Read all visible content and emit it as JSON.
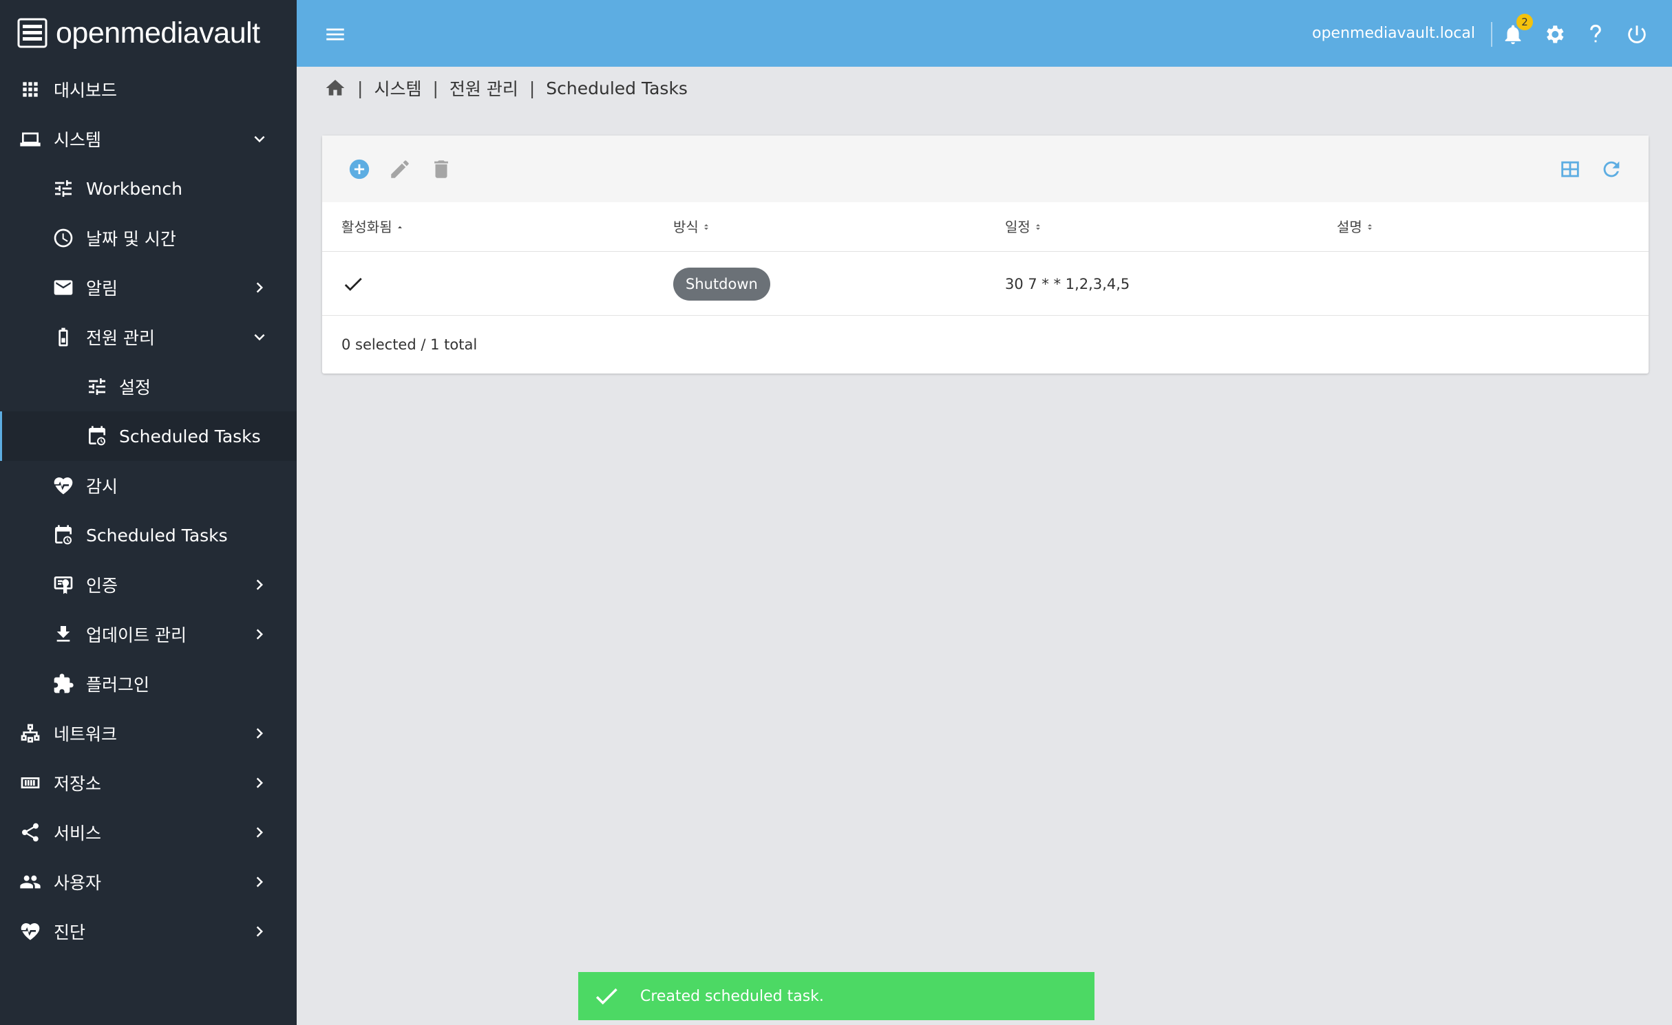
{
  "app": {
    "brand": "openmediavault"
  },
  "sidebar": {
    "items": [
      {
        "label": "대시보드",
        "icon": "dashboard-grid-icon"
      },
      {
        "label": "시스템",
        "icon": "laptop-icon",
        "expanded": true
      },
      {
        "label": "Workbench",
        "icon": "tune-icon"
      },
      {
        "label": "날짜 및 시간",
        "icon": "clock-icon"
      },
      {
        "label": "알림",
        "icon": "mail-icon"
      },
      {
        "label": "전원 관리",
        "icon": "battery-icon",
        "expanded": true
      },
      {
        "label": "설정",
        "icon": "tune-icon"
      },
      {
        "label": "Scheduled Tasks",
        "icon": "calendar-clock-icon",
        "active": true
      },
      {
        "label": "감시",
        "icon": "heart-pulse-icon"
      },
      {
        "label": "Scheduled Tasks",
        "icon": "calendar-clock-icon"
      },
      {
        "label": "인증",
        "icon": "certificate-icon"
      },
      {
        "label": "업데이트 관리",
        "icon": "download-icon"
      },
      {
        "label": "플러그인",
        "icon": "puzzle-icon"
      },
      {
        "label": "네트워크",
        "icon": "network-icon"
      },
      {
        "label": "저장소",
        "icon": "storage-icon"
      },
      {
        "label": "서비스",
        "icon": "share-icon"
      },
      {
        "label": "사용자",
        "icon": "users-icon"
      },
      {
        "label": "진단",
        "icon": "heart-pulse-icon"
      }
    ]
  },
  "topbar": {
    "hostname": "openmediavault.local",
    "notification_count": "2"
  },
  "breadcrumb": {
    "items": [
      "시스템",
      "전원 관리",
      "Scheduled Tasks"
    ]
  },
  "table": {
    "columns": [
      {
        "label": "활성화됨",
        "sort": "asc"
      },
      {
        "label": "방식",
        "sort": "none"
      },
      {
        "label": "일정",
        "sort": "none"
      },
      {
        "label": "설명",
        "sort": "none"
      }
    ],
    "rows": [
      {
        "enabled": true,
        "method": "Shutdown",
        "schedule": "30 7 * * 1,2,3,4,5",
        "description": ""
      }
    ],
    "footer": "0 selected / 1 total"
  },
  "toast": {
    "message": "Created scheduled task."
  },
  "colors": {
    "topbar": "#5dade2",
    "sidebar": "#232b35",
    "accent": "#5dade2",
    "toast": "#4cd964",
    "chip": "#6b7177"
  }
}
